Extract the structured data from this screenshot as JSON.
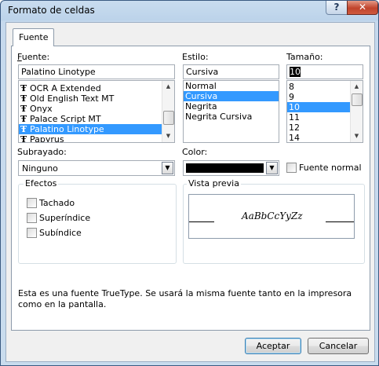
{
  "window": {
    "title": "Formato de celdas"
  },
  "titlebar": {
    "help": "?",
    "close": "✕"
  },
  "tabs": [
    {
      "label": "Fuente"
    }
  ],
  "font": {
    "label": "Fuente:",
    "value": "Palatino Linotype",
    "items": [
      "OCR A Extended",
      "Old English Text MT",
      "Onyx",
      "Palace Script MT",
      "Palatino Linotype",
      "Papyrus"
    ],
    "selected": "Palatino Linotype",
    "icon_glyph": "Ŧ"
  },
  "style": {
    "label": "Estilo:",
    "value": "Cursiva",
    "items": [
      "Normal",
      "Cursiva",
      "Negrita",
      "Negrita Cursiva"
    ],
    "selected": "Cursiva"
  },
  "size": {
    "label": "Tamaño:",
    "value": "10",
    "items": [
      "8",
      "9",
      "10",
      "11",
      "12",
      "14"
    ],
    "selected": "10"
  },
  "underline": {
    "label": "Subrayado:",
    "value": "Ninguno"
  },
  "color": {
    "label": "Color:",
    "swatch": "#000000",
    "normal_font_label": "Fuente normal"
  },
  "effects": {
    "title": "Efectos",
    "items": [
      {
        "label": "Tachado"
      },
      {
        "label": "Superíndice"
      },
      {
        "label": "Subíndice"
      }
    ]
  },
  "preview": {
    "title": "Vista previa",
    "sample": "AaBbCcYyZz"
  },
  "info_text": "Esta es una fuente TrueType. Se usará la misma fuente tanto en la impresora como en la pantalla.",
  "buttons": {
    "ok": "Aceptar",
    "cancel": "Cancelar"
  },
  "colors": {
    "selection": "#3399ff",
    "titlebar": "#c9dcef",
    "close": "#c0442c"
  }
}
